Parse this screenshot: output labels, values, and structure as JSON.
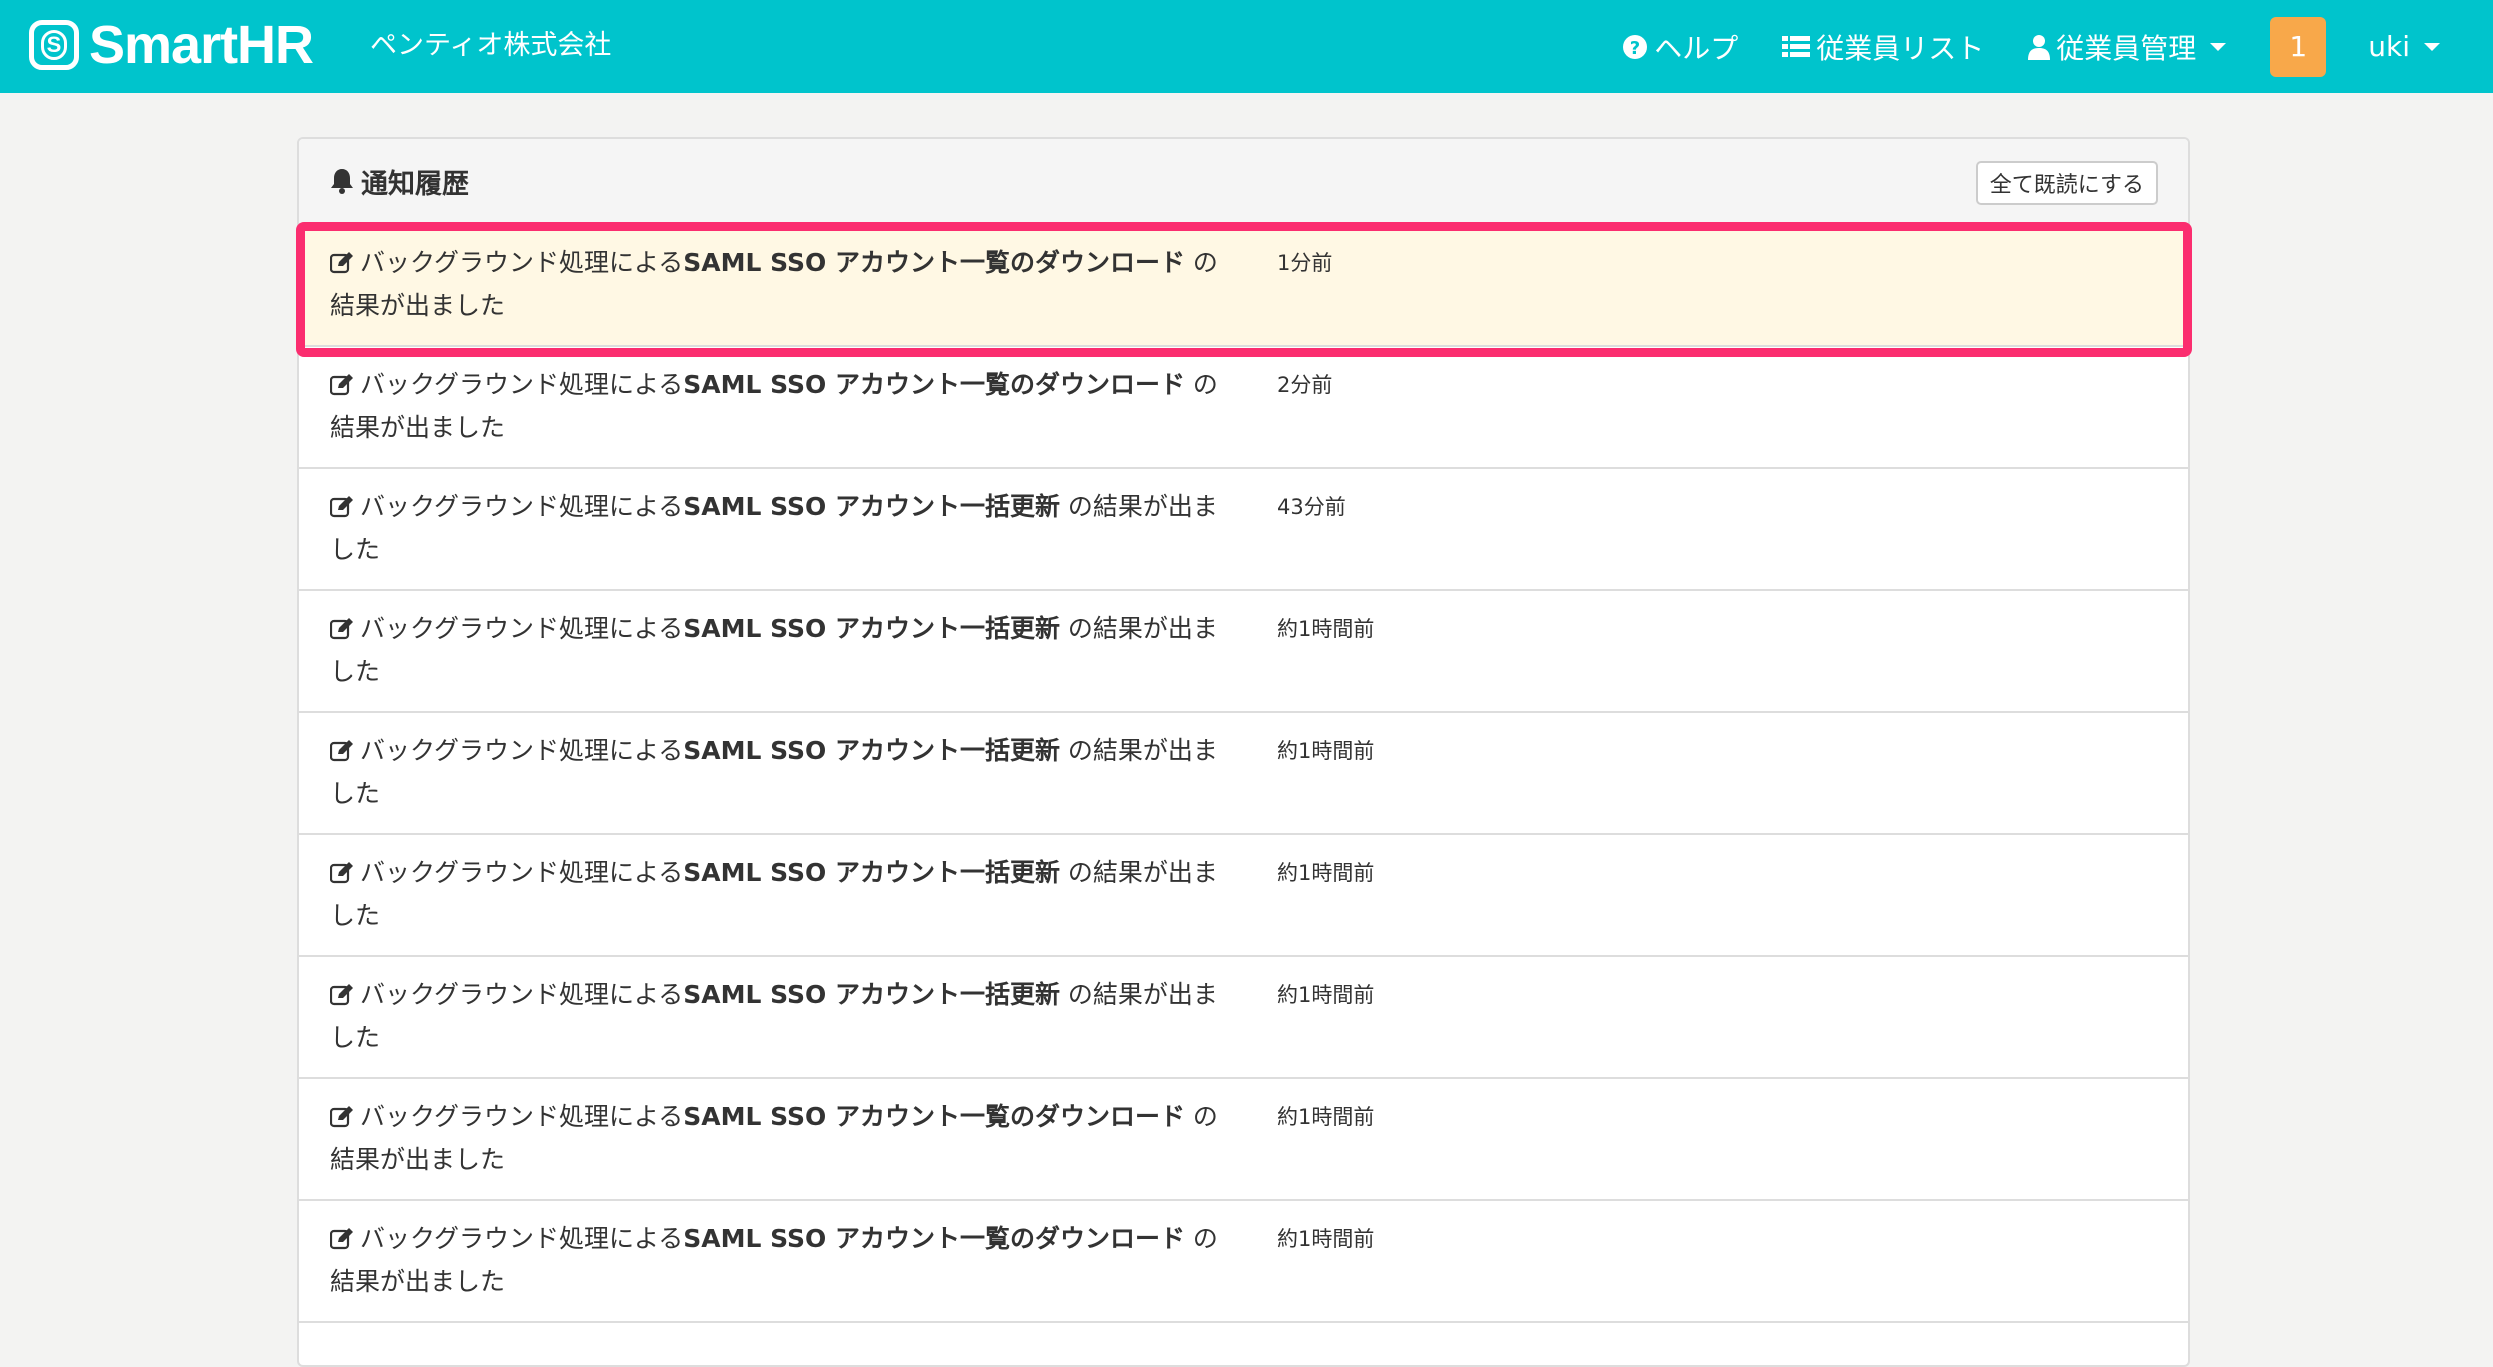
{
  "navbar": {
    "logo_text": "SmartHR",
    "logo_mark": "S",
    "company": "ペンティオ株式会社",
    "help_label": "ヘルプ",
    "employee_list_label": "従業員リスト",
    "employee_mgmt_label": "従業員管理",
    "notification_count": "1",
    "user_name": "uki",
    "background_color": "#00c4cc",
    "badge_color": "#f8a84a"
  },
  "panel": {
    "title": "通知履歴",
    "mark_all_read_label": "全て既読にする"
  },
  "notifications": [
    {
      "prefix": "バックグラウンド処理による",
      "task": "SAML SSO アカウント一覧のダウンロード",
      "suffix": " の結果が出ました",
      "time": "1分前",
      "unread": true
    },
    {
      "prefix": "バックグラウンド処理による",
      "task": "SAML SSO アカウント一覧のダウンロード",
      "suffix": " の結果が出ました",
      "time": "2分前",
      "unread": false
    },
    {
      "prefix": "バックグラウンド処理による",
      "task": "SAML SSO アカウント一括更新",
      "suffix": " の結果が出ました",
      "time": "43分前",
      "unread": false
    },
    {
      "prefix": "バックグラウンド処理による",
      "task": "SAML SSO アカウント一括更新",
      "suffix": " の結果が出ました",
      "time": "約1時間前",
      "unread": false
    },
    {
      "prefix": "バックグラウンド処理による",
      "task": "SAML SSO アカウント一括更新",
      "suffix": " の結果が出ました",
      "time": "約1時間前",
      "unread": false
    },
    {
      "prefix": "バックグラウンド処理による",
      "task": "SAML SSO アカウント一括更新",
      "suffix": " の結果が出ました",
      "time": "約1時間前",
      "unread": false
    },
    {
      "prefix": "バックグラウンド処理による",
      "task": "SAML SSO アカウント一括更新",
      "suffix": " の結果が出ました",
      "time": "約1時間前",
      "unread": false
    },
    {
      "prefix": "バックグラウンド処理による",
      "task": "SAML SSO アカウント一覧のダウンロード",
      "suffix": " の結果が出ました",
      "time": "約1時間前",
      "unread": false
    },
    {
      "prefix": "バックグラウンド処理による",
      "task": "SAML SSO アカウント一覧のダウンロード",
      "suffix": " の結果が出ました",
      "time": "約1時間前",
      "unread": false
    }
  ],
  "highlight_color": "#fb2d6f",
  "unread_row_color": "#fff8e4"
}
